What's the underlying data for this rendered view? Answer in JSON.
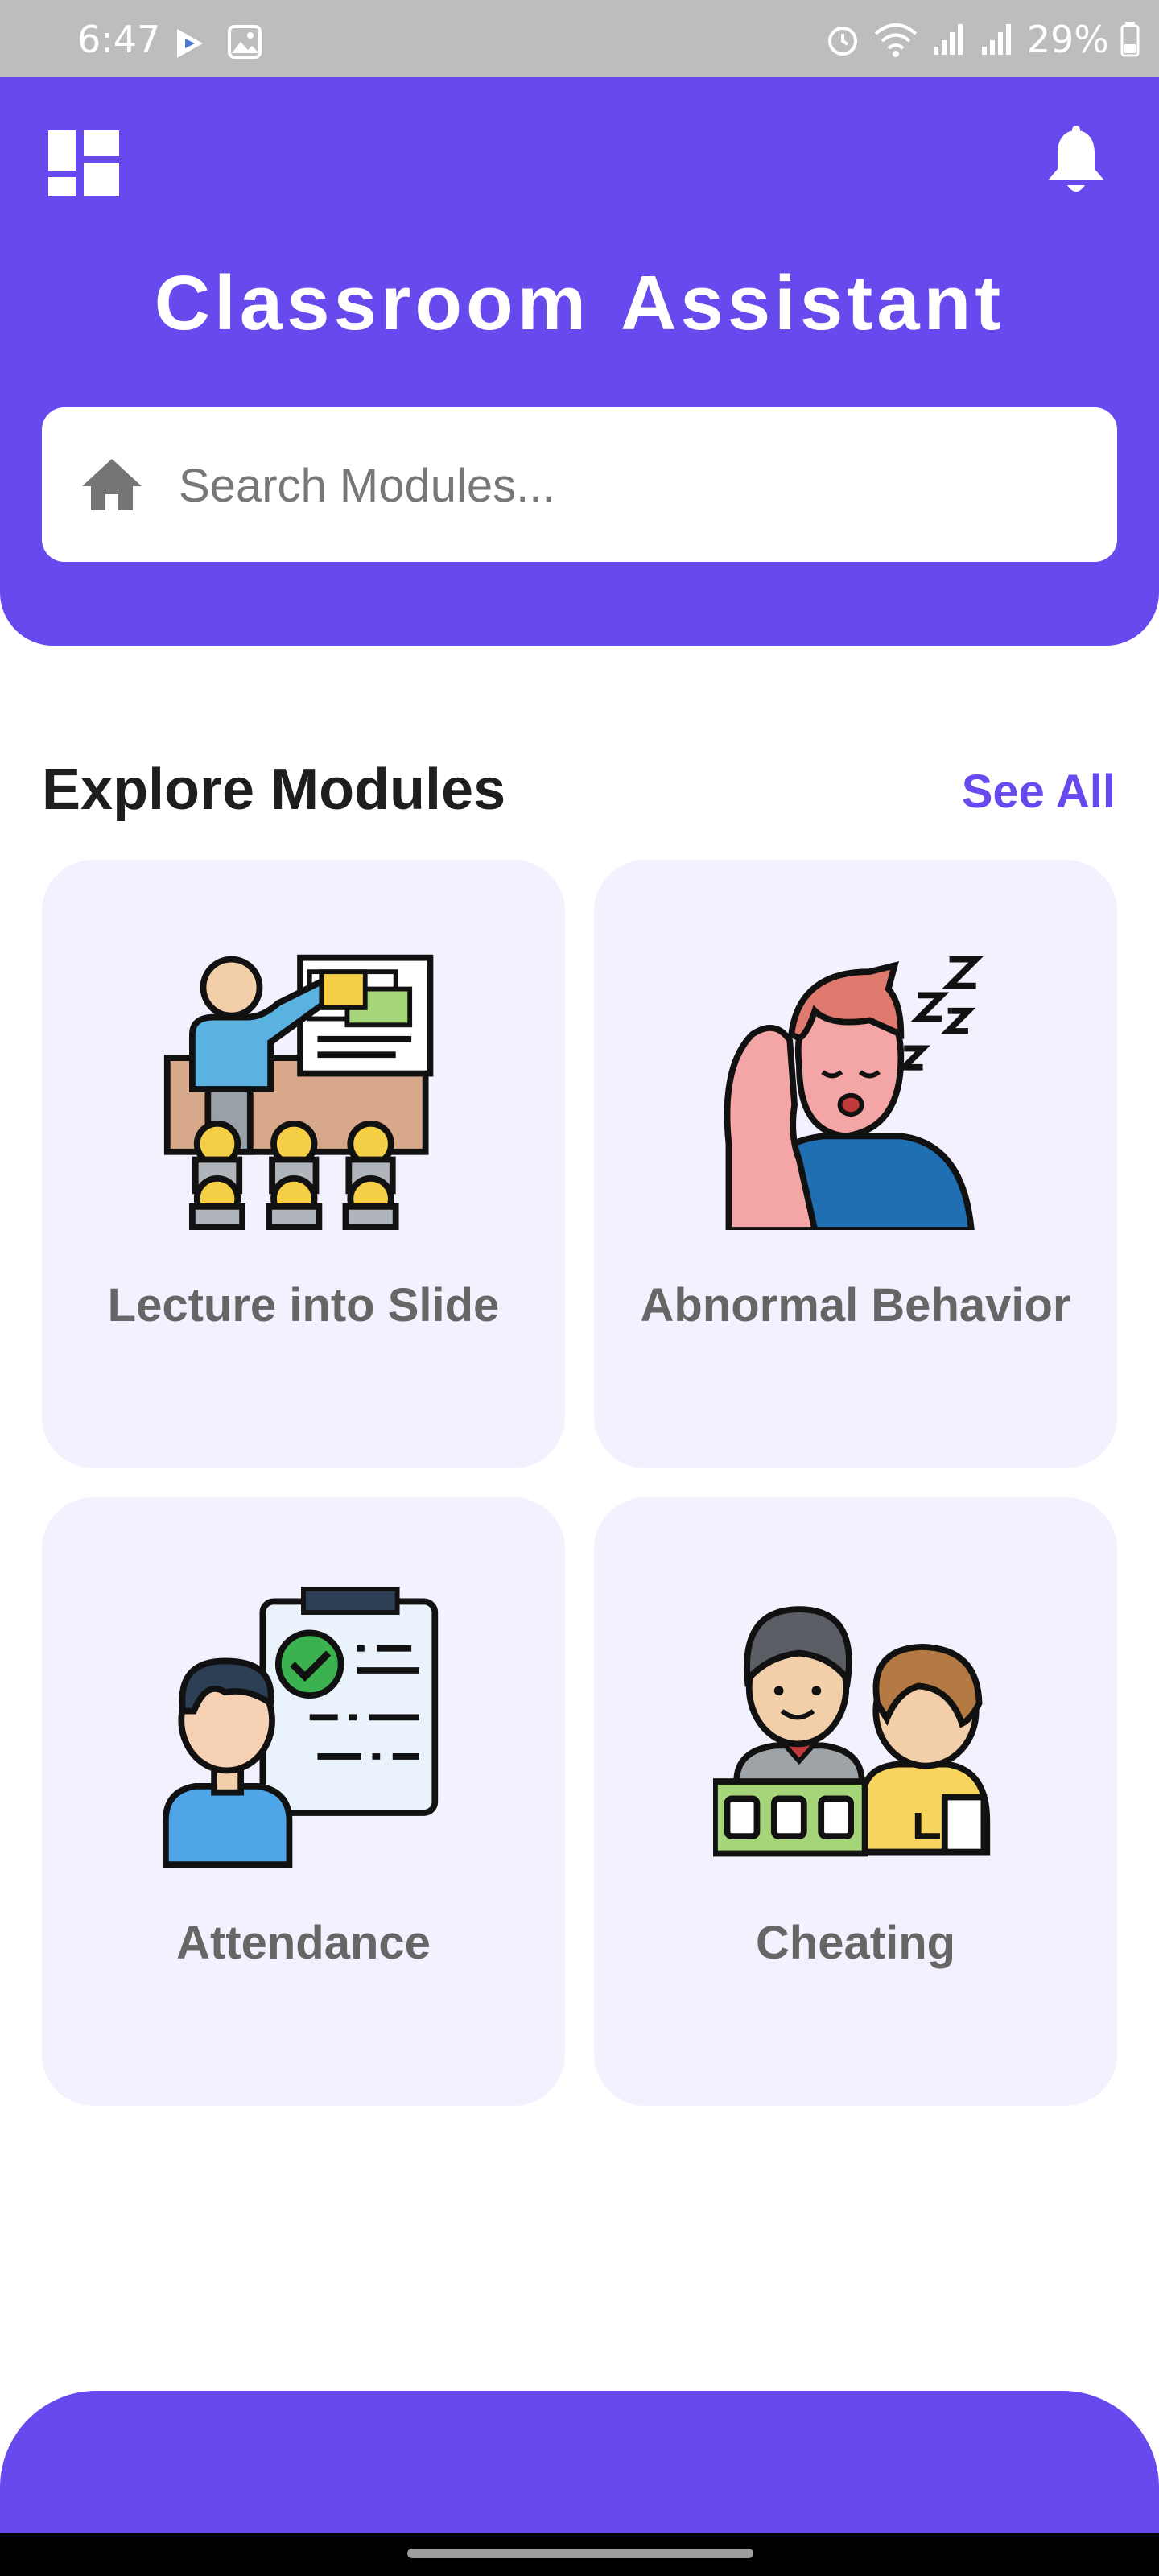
{
  "status_bar": {
    "time": "6:47",
    "battery": "29%"
  },
  "header": {
    "title": "Classroom Assistant"
  },
  "search": {
    "placeholder": "Search Modules..."
  },
  "section": {
    "title": "Explore Modules",
    "see_all_label": "See All"
  },
  "modules": [
    {
      "label": "Lecture into Slide",
      "icon": "lecture-presentation-icon"
    },
    {
      "label": "Abnormal Behavior",
      "icon": "sleeping-student-icon"
    },
    {
      "label": "Attendance",
      "icon": "attendance-checklist-icon"
    },
    {
      "label": "Cheating",
      "icon": "cheating-students-icon"
    }
  ],
  "colors": {
    "primary": "#6849ee",
    "card_background": "#f3f1fd",
    "status_bar": "#bdbdbd",
    "label_gray": "#666666"
  }
}
